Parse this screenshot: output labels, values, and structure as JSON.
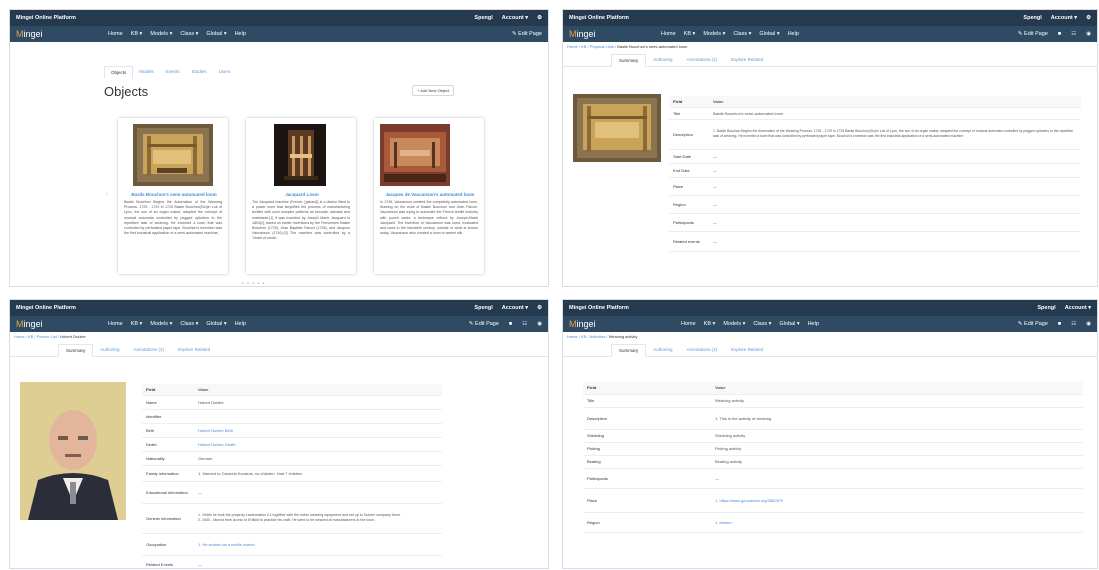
{
  "platform": "Mingei Online Platform",
  "logo": "Mingei",
  "topbar": {
    "user": "Spengl",
    "account": "Account ▾",
    "gear": "⚙"
  },
  "menu": [
    "Home",
    "KB ▾",
    "Models ▾",
    "Class ▾",
    "Global ▾",
    "Help"
  ],
  "nav_actions": {
    "edit": "✎ Edit Page",
    "sq": "■",
    "grid": "☷",
    "bell": "◉"
  },
  "panel1": {
    "tabs": [
      "Objects",
      "Models",
      "Events",
      "Studies",
      "Users"
    ],
    "title": "Objects",
    "add_button": "+ Add New Object",
    "prev": "‹",
    "next": "›",
    "dots": "• • • • •",
    "cards": [
      {
        "title": "Basile Bouchon's semi-automated loom",
        "desc": "Basile Bouchon Begins the Automation of the Weaving Process. 1725 - 1729 In 1725 Basile Bouchon(Glo)in Lok of Lyon, the son of an organ maker, adapted the concept of musical automata controlled by pegged cylinders to the repetitive task of weaving. He invented a loom that was controlled by perforated paper tape. Bouchon's invention was the first industrial application of a semi-automated machine."
      },
      {
        "title": "Jacquard Loom",
        "desc": "The Jacquard machine (French: [ʒakard]) is a device fitted to a power loom that simplifies the process of manufacturing textiles with such complex patterns as brocade, damask and matelassé.[1] It was invented by Joseph Marie Jacquard in 1804[2], based on earlier inventions by the Frenchmen Basile Bouchon (1725), Jean Baptiste Falcon (1728), and Jacques Vaucanson (1740).[3] The machine was controlled by a \"chain of cards\"."
      },
      {
        "title": "Jacques de Vaucanson's automated loom",
        "desc": "In 1745, Vaucanson created the completely automated loom, drawing on the work of Basile Bouchon and Jean Falcon. Vaucanson was trying to automate the French textile industry with punch cards; a technique refined by Joseph-Marie Jacquard. The invention of Vaucanson was used, evaluated and used in the twentieth century, outside of what is known today. Vaucanson also created a loom to weave silk."
      }
    ]
  },
  "panel2": {
    "breadcrumb": {
      "path": "Home / KB / Physical Lists / ",
      "current": "Basile Bouchon's semi-automated loom"
    },
    "tabs": [
      "Summary",
      "Authoring",
      "Annotations (2)",
      "Explore Related"
    ],
    "header": [
      "Field",
      "Value"
    ],
    "rows": [
      [
        "Title",
        "Basile Bouchon's semi-automated loom"
      ],
      [
        "Description",
        "1. Basile Bouchon Begins the Automation of the Weaving Process. 1725 - 1729 In 1725 Basile Bouchon(Glo)in Lok of Lyon, the son of an organ maker, adapted the concept of musical automata controlled by pegged cylinders to the repetitive task of weaving. He invented a loom that was controlled by perforated paper tape. Bouchon's invention was the first industrial application of a semi-automated machine."
      ],
      [
        "Start Date",
        "—"
      ],
      [
        "End Date",
        "—"
      ],
      [
        "Place",
        "—"
      ],
      [
        "Region",
        "—"
      ],
      [
        "Participants",
        "—"
      ],
      [
        "Related events",
        "—"
      ]
    ]
  },
  "panel3": {
    "breadcrumb": {
      "path": "Home / KB / Person List / ",
      "current": "Hubert Dutzler"
    },
    "tabs": [
      "Summary",
      "Authoring",
      "Annotations (2)",
      "Explore Related"
    ],
    "header": [
      "Field",
      "Value"
    ],
    "rows": [
      [
        "Name",
        "Hubert Dutzler",
        false
      ],
      [
        "Identifier",
        "",
        false
      ],
      [
        "Birth",
        "Hubert Dutzler Birth",
        true
      ],
      [
        "Death",
        "Hubert Dutzler Death",
        true
      ],
      [
        "Nationality",
        "German",
        false
      ],
      [
        "Family information",
        "1. Married to Carmela Kundras, no children. Had 7 children",
        false
      ],
      [
        "Educational information",
        "—",
        false
      ],
      [
        "Generic information",
        "1. 1940s he took the property Lavaranticks C1 together with the entire weaving equipment and set up to Dutzler company there.\n2. 1940 - Moved from Aronic to Ertikidi to practice his craft. He went to be weaved at manufacturers in the town.",
        false
      ],
      [
        "Occupation",
        "1. He worked as a textile worker",
        true
      ],
      [
        "Related Events",
        "—",
        false
      ]
    ]
  },
  "panel4": {
    "breadcrumb": {
      "path": "Home / KB / Activities / ",
      "current": "Weaving activity"
    },
    "tabs": [
      "Summary",
      "Authoring",
      "Annotations (2)",
      "Explore Related"
    ],
    "header": [
      "Field",
      "Value"
    ],
    "rows": [
      [
        "Title",
        "Weaving activity",
        false
      ],
      [
        "Description",
        "1. This is the activity of weaving",
        false
      ],
      [
        "Shedding",
        "Shedding activity",
        false
      ],
      [
        "Picking",
        "Picking activity",
        false
      ],
      [
        "Beating",
        "Beating activity",
        false
      ],
      [
        "Participants",
        "—",
        false
      ],
      [
        "Place",
        "1. https://www.geonames.org/2860570",
        true
      ],
      [
        "Region",
        "1. Ariiden",
        true
      ]
    ]
  },
  "colors": {
    "topbar": "#253a4e",
    "navbar": "#2f4a63",
    "link": "#4a8bd4",
    "accent": "#e8a34b"
  }
}
